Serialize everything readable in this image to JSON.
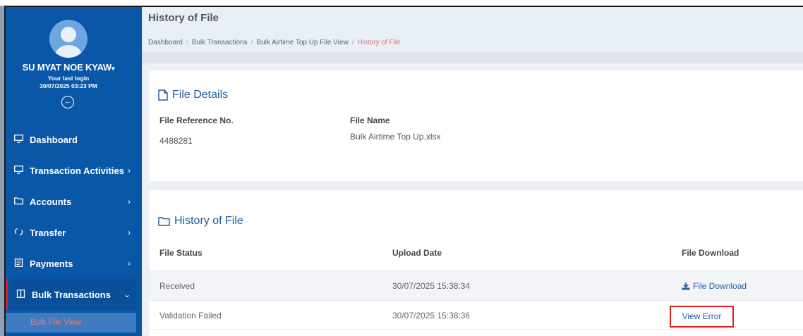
{
  "user": {
    "name": "SU MYAT NOE KYAW",
    "caret": "▾",
    "last_login_label": "Your last login",
    "last_login_date": "30/07/2025 03:23 PM"
  },
  "sidebar": {
    "items": [
      {
        "label": "Dashboard",
        "icon": "monitor-icon"
      },
      {
        "label": "Transaction Activities",
        "icon": "monitor-icon"
      },
      {
        "label": "Accounts",
        "icon": "folder-icon"
      },
      {
        "label": "Transfer",
        "icon": "refresh-icon"
      },
      {
        "label": "Payments",
        "icon": "document-icon"
      },
      {
        "label": "Bulk Transactions",
        "icon": "columns-icon"
      }
    ],
    "sub_items": [
      {
        "label": "Bulk File View"
      }
    ],
    "chevron_right": "›",
    "chevron_down": "⌄"
  },
  "header": {
    "title": "History of File",
    "breadcrumb": [
      "Dashboard",
      "Bulk Transactions",
      "Bulk Airtime Top Up File View",
      "History of File"
    ]
  },
  "file_details": {
    "title": "File Details",
    "ref_label": "File Reference No.",
    "ref_value": "4488281",
    "name_label": "File Name",
    "name_value": "Bulk Airtime Top Up.xlsx"
  },
  "history": {
    "title": "History of File",
    "columns": [
      "File Status",
      "Upload Date",
      "File Download"
    ],
    "rows": [
      {
        "status": "Received",
        "date": "30/07/2025 15:38:34",
        "action": "File Download"
      },
      {
        "status": "Validation Failed",
        "date": "30/07/2025 15:38:36",
        "action": "View Error"
      }
    ]
  },
  "colors": {
    "sidebar_bg": "#0a57a8",
    "accent_red": "#e0201c",
    "link_blue": "#1f5fa8"
  }
}
